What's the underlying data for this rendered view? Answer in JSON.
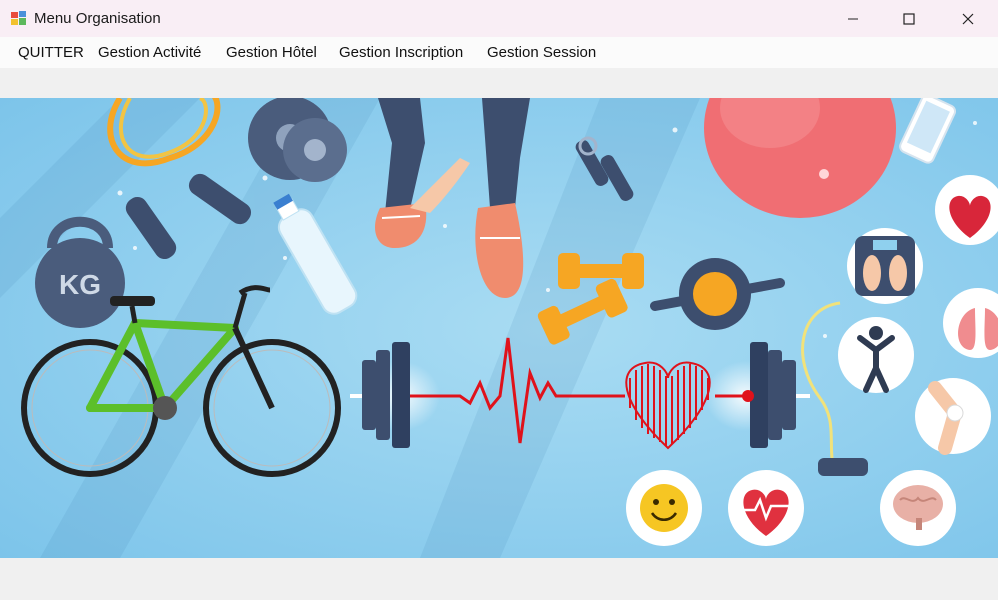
{
  "window": {
    "title": "Menu Organisation"
  },
  "menu": {
    "items": [
      {
        "label": "QUITTER"
      },
      {
        "label": "Gestion Activité"
      },
      {
        "label": "Gestion Hôtel"
      },
      {
        "label": "Gestion Inscription"
      },
      {
        "label": "Gestion Session"
      }
    ]
  },
  "banner": {
    "kettlebell_text": "KG",
    "colors": {
      "background": "#8fd0ee",
      "heartline": "#e0121b",
      "bike_frame": "#5cbf2a",
      "ball": "#f06e73"
    }
  }
}
